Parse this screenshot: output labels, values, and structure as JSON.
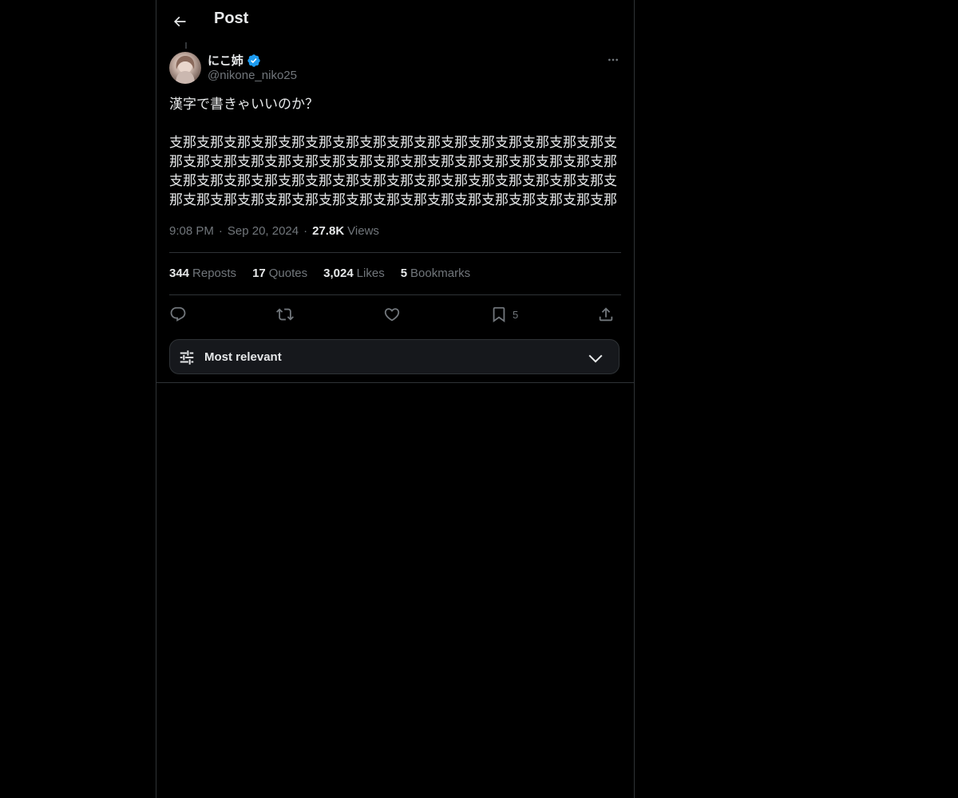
{
  "header": {
    "title": "Post"
  },
  "author": {
    "display_name": "にこ姉",
    "handle": "@nikone_niko25",
    "verified": true
  },
  "tweet": {
    "text_lines": [
      "漢字で書きゃいいのか？",
      "支那支那支那支那支那支那支那支那支那支那支那支那支那支那支那支那支那支那支那支那支那支那支那支那支那支那支那支那支那支那支那支那支那支那支那支那支那支那支那支那支那支那支那支那支那支那支那支那支那支那支那支那支那支那支那支那支那支那支那支那支那支那支那支那支那支那"
    ],
    "time": "9:08 PM",
    "date": "Sep 20, 2024",
    "views_count": "27.8K",
    "views_label": "Views"
  },
  "stats": {
    "reposts": {
      "count": "344",
      "label": "Reposts"
    },
    "quotes": {
      "count": "17",
      "label": "Quotes"
    },
    "likes": {
      "count": "3,024",
      "label": "Likes"
    },
    "bookmarks": {
      "count": "5",
      "label": "Bookmarks"
    }
  },
  "actions": {
    "reply_icon": "reply-icon",
    "repost_icon": "repost-icon",
    "like_icon": "heart-icon",
    "bookmark_icon": "bookmark-icon",
    "bookmark_count": "5",
    "share_icon": "share-icon"
  },
  "sort": {
    "label": "Most relevant"
  },
  "colors": {
    "background": "#000000",
    "text_primary": "#e7e9ea",
    "text_secondary": "#71767b",
    "border": "#2f3336",
    "verified_blue": "#1d9bf0",
    "sort_bg": "#16181c"
  }
}
